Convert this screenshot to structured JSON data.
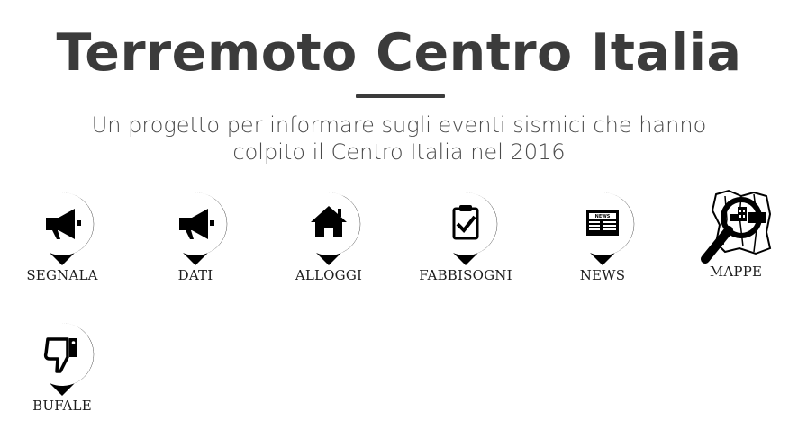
{
  "header": {
    "title": "Terremoto Centro Italia",
    "subtitle": "Un progetto per informare sugli eventi sismici che hanno colpito il Centro Italia nel 2016"
  },
  "menu": {
    "items": [
      {
        "label": "SEGNALA",
        "icon": "megaphone-pin-icon"
      },
      {
        "label": "DATI",
        "icon": "megaphone-pin-icon"
      },
      {
        "label": "ALLOGGI",
        "icon": "house-pin-icon"
      },
      {
        "label": "FABBISOGNI",
        "icon": "clipboard-check-pin-icon"
      },
      {
        "label": "NEWS",
        "icon": "newspaper-pin-icon"
      },
      {
        "label": "MAPPE",
        "icon": "map-magnifier-icon"
      },
      {
        "label": "BUFALE",
        "icon": "thumbs-down-pin-icon"
      }
    ],
    "news_badge_text": "NEWS"
  },
  "colors": {
    "title": "#3b3b3b",
    "icon": "#000000",
    "background": "#ffffff"
  }
}
